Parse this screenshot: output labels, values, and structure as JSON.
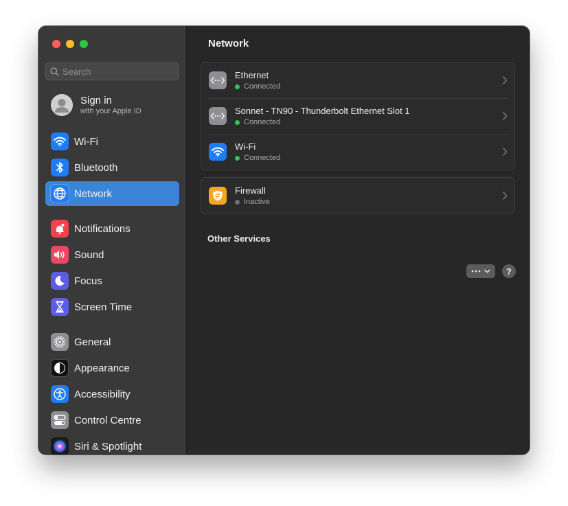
{
  "window": {
    "controls": [
      "close",
      "minimize",
      "zoom"
    ]
  },
  "sidebar": {
    "search": {
      "placeholder": "Search",
      "value": ""
    },
    "account": {
      "title": "Sign in",
      "subtitle": "with your Apple ID"
    },
    "items": [
      {
        "label": "Wi-Fi",
        "icon": "wifi-icon",
        "color": "#1f7cf5"
      },
      {
        "label": "Bluetooth",
        "icon": "bluetooth-icon",
        "color": "#1f7cf5"
      },
      {
        "label": "Network",
        "icon": "globe-icon",
        "color": "#1f7cf5",
        "selected": true
      },
      {
        "label": "Notifications",
        "icon": "bell-icon",
        "color": "#f0434e"
      },
      {
        "label": "Sound",
        "icon": "speaker-icon",
        "color": "#f24563"
      },
      {
        "label": "Focus",
        "icon": "moon-icon",
        "color": "#5e5ce6"
      },
      {
        "label": "Screen Time",
        "icon": "hourglass-icon",
        "color": "#5e5ce6"
      },
      {
        "label": "General",
        "icon": "gear-icon",
        "color": "#8e8e93"
      },
      {
        "label": "Appearance",
        "icon": "appearance-icon",
        "color": "#111111"
      },
      {
        "label": "Accessibility",
        "icon": "accessibility-icon",
        "color": "#1f7cf5"
      },
      {
        "label": "Control Centre",
        "icon": "toggles-icon",
        "color": "#8e8e93"
      },
      {
        "label": "Siri & Spotlight",
        "icon": "siri-icon",
        "color": "#1a1a1a"
      }
    ]
  },
  "main": {
    "title": "Network",
    "services": [
      {
        "name": "Ethernet",
        "status": "Connected",
        "status_color": "#31c553",
        "icon": "ethernet-icon"
      },
      {
        "name": "Sonnet - TN90 - Thunderbolt Ethernet Slot 1",
        "status": "Connected",
        "status_color": "#31c553",
        "icon": "ethernet-icon"
      },
      {
        "name": "Wi-Fi",
        "status": "Connected",
        "status_color": "#31c553",
        "icon": "wifi-icon"
      }
    ],
    "firewall": {
      "name": "Firewall",
      "status": "Inactive",
      "status_color": "#707070",
      "icon": "firewall-icon"
    },
    "other_services_title": "Other Services",
    "help_label": "?"
  }
}
